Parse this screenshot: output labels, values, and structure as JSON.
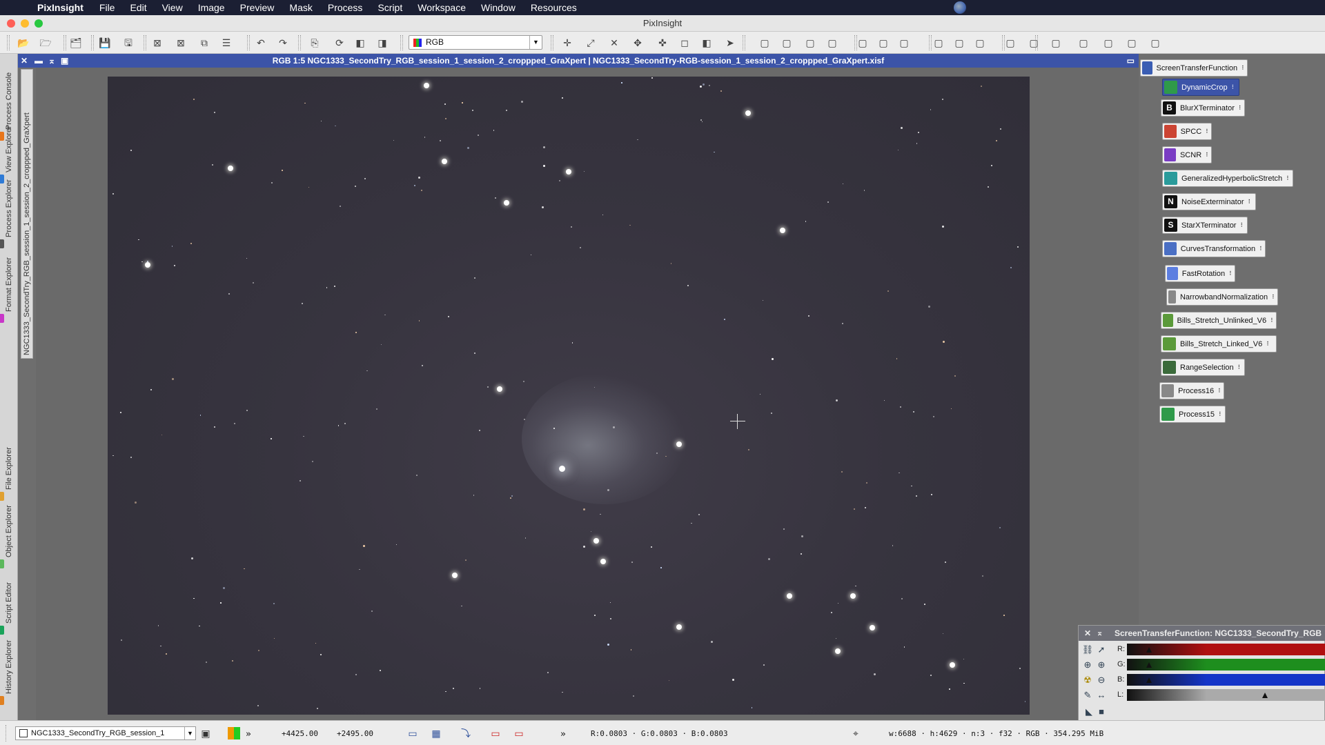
{
  "menubar": {
    "apple": "",
    "app": "PixInsight",
    "items": [
      "File",
      "Edit",
      "View",
      "Image",
      "Preview",
      "Mask",
      "Process",
      "Script",
      "Workspace",
      "Window",
      "Resources"
    ]
  },
  "window": {
    "title": "PixInsight"
  },
  "toolbar": {
    "channel_select": "RGB",
    "icons": [
      "open-icon",
      "open-folder-icon",
      "open-project-icon",
      "save-icon",
      "save-as-icon",
      "close-icon",
      "close-all-icon",
      "duplicate-icon",
      "properties-icon",
      "undo-icon",
      "redo-icon",
      "extract-icon",
      "identify-icon",
      "color-icon",
      "mask-icon",
      "pan-icon",
      "zoom-fit-icon",
      "zoom-1-icon",
      "move-icon",
      "center-icon",
      "crop-icon",
      "preview-icon",
      "pointer-icon"
    ]
  },
  "image_window": {
    "title": "RGB 1:5 NGC1333_SecondTry_RGB_session_1_session_2_croppped_GraXpert | NGC1333_SecondTry-RGB-session_1_session_2_croppped_GraXpert.xisf",
    "vertical_id": "NGC1333_SecondTry_RGB_session_1_session_2_croppped_GraXpert"
  },
  "left_tabs": [
    "Process Console",
    "View Explorer",
    "Process Explorer",
    "Format Explorer",
    "File Explorer",
    "Object Explorer",
    "Script Editor",
    "History Explorer"
  ],
  "process_icons": [
    {
      "label": "ScreenTransferFunction",
      "color": "#3a5db3",
      "glyph": ""
    },
    {
      "label": "DynamicCrop",
      "color": "#2f9a4a",
      "glyph": "",
      "selected": true
    },
    {
      "label": "BlurXTerminator",
      "color": "#111",
      "glyph": "B"
    },
    {
      "label": "SPCC",
      "color": "#c43",
      "glyph": ""
    },
    {
      "label": "SCNR",
      "color": "#7a3cc4",
      "glyph": ""
    },
    {
      "label": "GeneralizedHyperbolicStretch",
      "color": "#2a9b9b",
      "glyph": ""
    },
    {
      "label": "NoiseExterminator",
      "color": "#111",
      "glyph": "N"
    },
    {
      "label": "StarXTerminator",
      "color": "#111",
      "glyph": "S"
    },
    {
      "label": "CurvesTransformation",
      "color": "#4a6fc4",
      "glyph": ""
    },
    {
      "label": "FastRotation",
      "color": "#5c7ee0",
      "glyph": ""
    },
    {
      "label": "NarrowbandNormalization",
      "color": "#888",
      "glyph": ""
    },
    {
      "label": "Bills_Stretch_Unlinked_V6",
      "color": "#5b9a3a",
      "glyph": ""
    },
    {
      "label": "Bills_Stretch_Linked_V6",
      "color": "#5b9a3a",
      "glyph": ""
    },
    {
      "label": "RangeSelection",
      "color": "#3b6b3b",
      "glyph": ""
    },
    {
      "label": "Process16",
      "color": "#888",
      "glyph": ""
    },
    {
      "label": "Process15",
      "color": "#2f9a4a",
      "glyph": ""
    }
  ],
  "stf": {
    "title": "ScreenTransferFunction: NGC1333_SecondTry_RGB",
    "channels": [
      {
        "label": "R:",
        "color": "#b01010"
      },
      {
        "label": "G:",
        "color": "#1e8e1e"
      },
      {
        "label": "B:",
        "color": "#1535c8"
      },
      {
        "label": "L:",
        "color": "#aaaaaa"
      }
    ]
  },
  "status": {
    "view": "NGC1333_SecondTry_RGB_session_1",
    "x": "+4425.00",
    "y": "+2495.00",
    "more": "»",
    "rgb": "R:0.0803 · G:0.0803 · B:0.0803",
    "info": "w:6688 · h:4629 · n:3 · f32 · RGB · 354.295 MiB"
  }
}
